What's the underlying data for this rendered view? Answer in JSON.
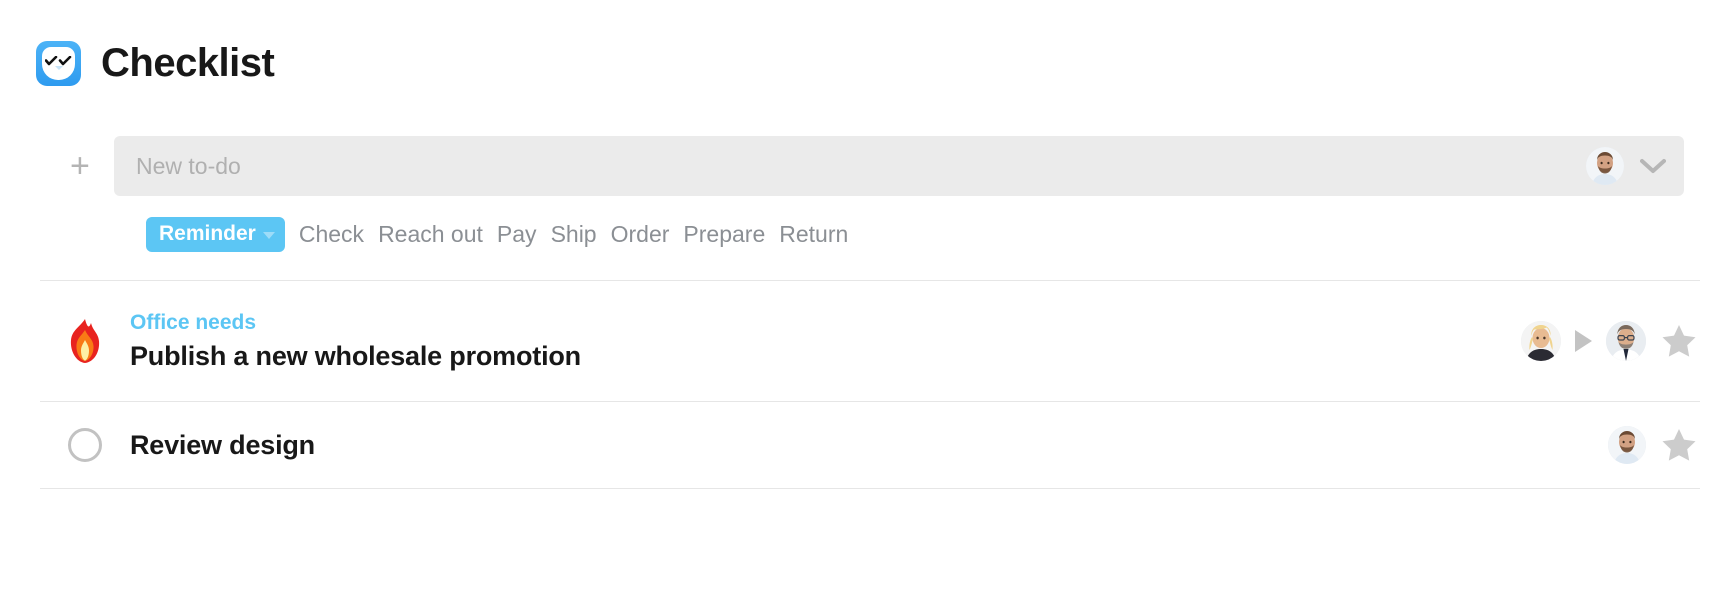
{
  "header": {
    "title": "Checklist",
    "icon": "checklist-app-icon"
  },
  "composer": {
    "add_label": "+",
    "placeholder": "New to-do",
    "value": "",
    "assignee_avatar": "avatar-bearded-man",
    "expand_icon": "chevron-down-icon"
  },
  "tags": {
    "selected": "Reminder",
    "options": [
      "Check",
      "Reach out",
      "Pay",
      "Ship",
      "Order",
      "Prepare",
      "Return"
    ]
  },
  "tasks": [
    {
      "lead_icon": "flame-icon",
      "tag": "Office needs",
      "title": "Publish a new wholesale promotion",
      "assignees": [
        "avatar-blonde-woman",
        "avatar-man-glasses"
      ],
      "delegation_icon": "play-triangle-icon",
      "star_icon": "star-icon"
    },
    {
      "lead_icon": "radio-circle-icon",
      "tag": "",
      "title": "Review design",
      "assignees": [
        "avatar-bearded-man"
      ],
      "delegation_icon": "",
      "star_icon": "star-icon"
    }
  ],
  "colors": {
    "accent": "#5cc6f4",
    "app_icon": "#3fa9f5",
    "input_bg": "#ebebeb",
    "star": "#cccccc",
    "divider": "#e6e6e6",
    "text": "#181818",
    "muted": "#8b8f94"
  }
}
